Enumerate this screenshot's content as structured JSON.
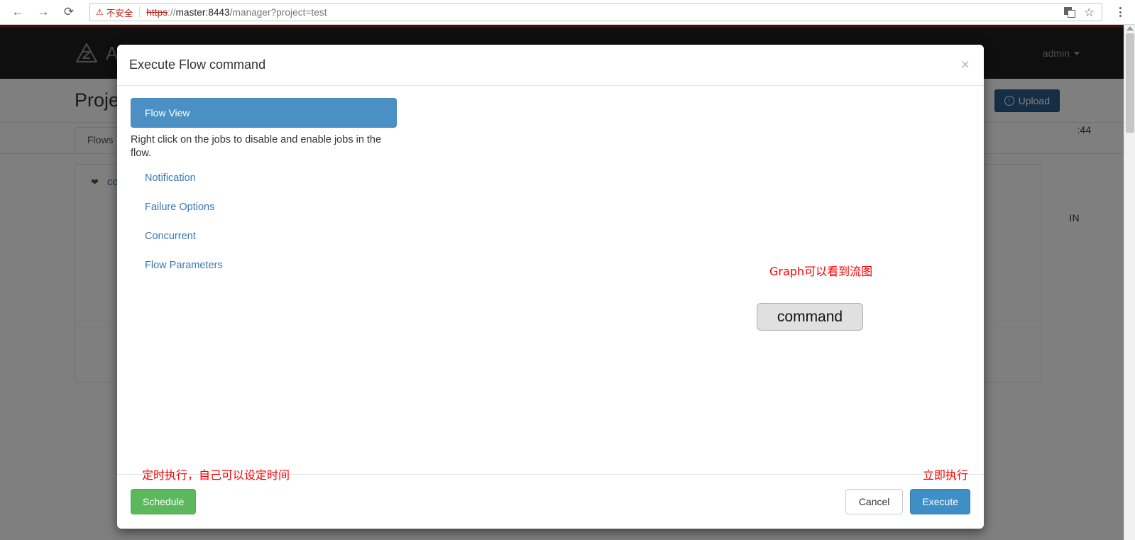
{
  "browser": {
    "back_icon": "arrow-left-icon",
    "forward_icon": "arrow-right-icon",
    "reload_icon": "reload-icon",
    "security_label": "不安全",
    "warning_glyph": "⚠",
    "url": {
      "scheme": "https",
      "separator": "://",
      "host": "master:8443",
      "path": "/manager?project=test",
      "full": "https://master:8443/manager?project=test"
    },
    "translate_icon": "translate-icon",
    "bookmark_icon": "star-icon",
    "menu_icon": "three-dots-menu-icon",
    "star_glyph": "☆"
  },
  "app": {
    "brand": "Azkaban",
    "brand_logo_icon": "azkaban-logo-icon",
    "user": "admin",
    "page_title": "Project",
    "upload_label": "Upload",
    "upload_icon": "circle-up-arrow-icon",
    "upload_glyph": "↑",
    "tab_flows": "Flows",
    "flow_name": "command",
    "flow_chevron_icon": "chevron-down-icon",
    "flow_chevron_glyph": "❤",
    "meta_time": ":44",
    "meta_admin": "IN"
  },
  "modal": {
    "title": "Execute Flow command",
    "close_icon": "close-icon",
    "close_glyph": "×",
    "tab_flow_view": "Flow View",
    "hint": "Right click on the jobs to disable and enable jobs in the flow.",
    "links": [
      {
        "label": "Notification"
      },
      {
        "label": "Failure Options"
      },
      {
        "label": "Concurrent"
      },
      {
        "label": "Flow Parameters"
      }
    ],
    "graph": {
      "annotation": "Graph可以看到流图",
      "node_label": "command"
    },
    "footer": {
      "schedule_label": "Schedule",
      "cancel_label": "Cancel",
      "execute_label": "Execute",
      "schedule_note": "定时执行，自己可以设定时间",
      "execute_note": "立即执行"
    }
  },
  "colors": {
    "primary_blue": "#428bca",
    "tab_blue": "#4a90c4",
    "success_green": "#5cb85c",
    "upload_blue": "#2a5d8c",
    "accent_red": "#8b1a10",
    "annotation_red": "#ff0000",
    "link_blue": "#3a77b5"
  }
}
